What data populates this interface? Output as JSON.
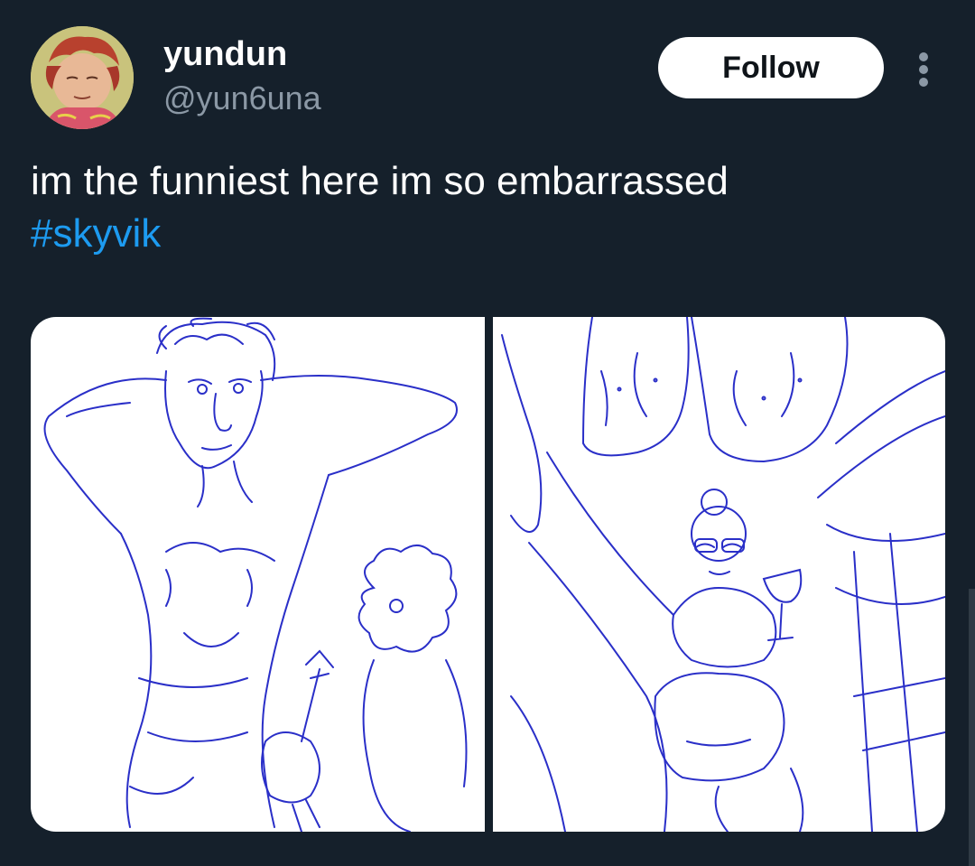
{
  "user": {
    "display_name": "yundun",
    "handle": "@yun6una",
    "avatar_icon": "avatar-illustration"
  },
  "actions": {
    "follow_label": "Follow",
    "more_icon": "more-vertical-icon"
  },
  "tweet": {
    "text": "im the funniest here im so embarrassed",
    "hashtag": "#skyvik"
  },
  "colors": {
    "background": "#15202b",
    "text_primary": "#ffffff",
    "text_secondary": "#8b98a5",
    "link": "#1d9bf0",
    "sketch_ink": "#2a2fc8"
  }
}
